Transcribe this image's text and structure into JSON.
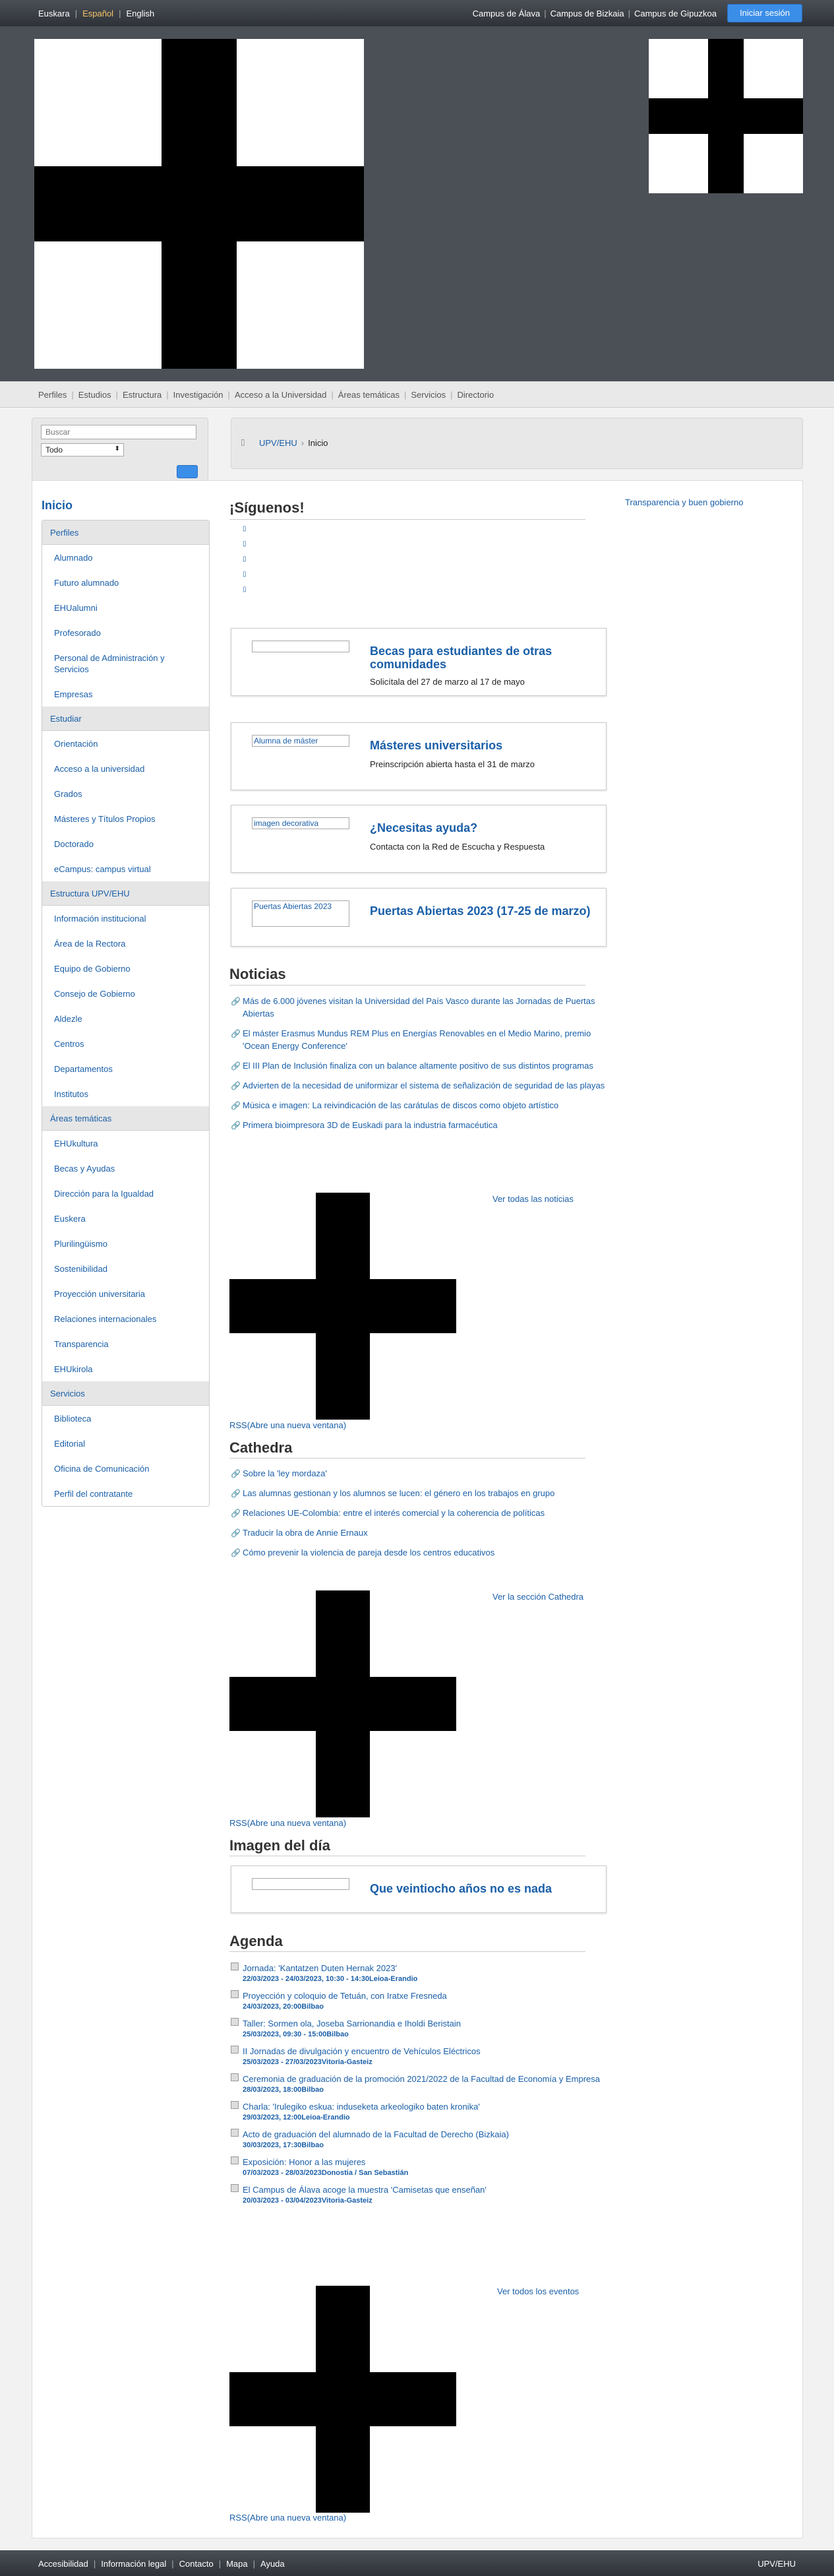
{
  "topbar": {
    "languages": [
      "Euskara",
      "Español",
      "English"
    ],
    "campuses": [
      "Campus de Álava",
      "Campus de Bizkaia",
      "Campus de Gipuzkoa"
    ],
    "login": "Iniciar sesión"
  },
  "menu": [
    "Perfiles",
    "Estudios",
    "Estructura",
    "Investigación",
    "Acceso a la Universidad",
    "Áreas temáticas",
    "Servicios",
    "Directorio"
  ],
  "search": {
    "placeholder": "Buscar",
    "scope": "Todo"
  },
  "breadcrumb": {
    "root": "UPV/EHU",
    "current": "Inicio"
  },
  "left": {
    "title": "Inicio",
    "groups": [
      {
        "head": "Perfiles",
        "items": [
          "Alumnado",
          "Futuro alumnado",
          "EHUalumni",
          "Profesorado",
          "Personal de Administración y Servicios",
          "Empresas"
        ]
      },
      {
        "head": "Estudiar",
        "items": [
          "Orientación",
          "Acceso a la universidad",
          "Grados",
          "Másteres y Títulos Propios",
          "Doctorado",
          "eCampus: campus virtual"
        ]
      },
      {
        "head": "Estructura UPV/EHU",
        "items": [
          "Información institucional",
          "Área de la Rectora",
          "Equipo de Gobierno",
          "Consejo de Gobierno",
          "Aldezle",
          "Centros",
          "Departamentos",
          "Institutos"
        ]
      },
      {
        "head": "Áreas temáticas",
        "items": [
          "EHUkultura",
          "Becas y Ayudas",
          "Dirección para la Igualdad",
          "Euskera",
          "Plurilingüismo",
          "Sostenibilidad",
          "Proyección universitaria",
          "Relaciones internacionales",
          "Transparencia",
          "EHUkirola"
        ]
      },
      {
        "head": "Servicios",
        "items": [
          "Biblioteca",
          "Editorial",
          "Oficina de Comunicación",
          "Perfil del contratante"
        ]
      }
    ]
  },
  "right": {
    "transparency": "Transparencia y buen gobierno"
  },
  "follow": {
    "title": "¡Síguenos!"
  },
  "cards": [
    {
      "img": "",
      "title": "Becas para estudiantes de otras comunidades",
      "text": "Solicítala del 27 de marzo al 17 de mayo"
    },
    {
      "img": "Alumna de máster",
      "title": "Másteres universitarios",
      "text": "Preinscripción abierta hasta el 31 de marzo"
    },
    {
      "img": "imagen decorativa",
      "title": "¿Necesitas ayuda?",
      "text": "Contacta con la Red de Escucha y Respuesta"
    },
    {
      "img": "Puertas Abiertas 2023",
      "title": "Puertas Abiertas 2023 (17-25 de marzo)",
      "text": ""
    }
  ],
  "news": {
    "title": "Noticias",
    "items": [
      "Más de 6.000 jóvenes visitan la Universidad del País Vasco durante las Jornadas de Puertas Abiertas",
      "El máster Erasmus Mundus REM Plus en Energías Renovables en el Medio Marino, premio 'Ocean Energy Conference'",
      "El III Plan de Inclusión finaliza con un balance altamente positivo de sus distintos programas",
      "Advierten de la necesidad de uniformizar el sistema de señalización de seguridad de las playas",
      "Música e imagen: La reivindicación de las carátulas de discos como objeto artístico",
      "Primera bioimpresora 3D de Euskadi para la industria farmacéutica"
    ],
    "see_all": "Ver todas las noticias",
    "rss": "RSS(Abre una nueva ventana)"
  },
  "cathedra": {
    "title": "Cathedra",
    "items": [
      "Sobre la 'ley mordaza'",
      "Las alumnas gestionan y los alumnos se lucen: el género en los trabajos en grupo",
      "Relaciones UE-Colombia: entre el interés comercial y la coherencia de políticas",
      "Traducir la obra de Annie Ernaux",
      "Cómo prevenir la violencia de pareja desde los centros educativos"
    ],
    "see_all": "Ver la sección Cathedra",
    "rss": "RSS(Abre una nueva ventana)"
  },
  "image_of_day": {
    "title": "Imagen del día",
    "caption": "Que veintiocho años no es nada"
  },
  "agenda": {
    "title": "Agenda",
    "items": [
      {
        "t": "Jornada: 'Kantatzen Duten Hernak 2023'",
        "m": "22/03/2023 - 24/03/2023, 10:30 - 14:30Leioa-Erandio"
      },
      {
        "t": "Proyección y coloquio de Tetuán, con Iratxe Fresneda",
        "m": "24/03/2023, 20:00Bilbao"
      },
      {
        "t": "Taller: Sormen ola, Joseba Sarrionandia e Iholdi Beristain",
        "m": "25/03/2023, 09:30 - 15:00Bilbao"
      },
      {
        "t": "II Jornadas de divulgación y encuentro de Vehículos Eléctricos",
        "m": "25/03/2023 - 27/03/2023Vitoria-Gasteiz"
      },
      {
        "t": "Ceremonia de graduación de la promoción 2021/2022 de la Facultad de Economía y Empresa",
        "m": "28/03/2023, 18:00Bilbao"
      },
      {
        "t": "Charla: 'Irulegiko eskua: induseketa arkeologiko baten kronika'",
        "m": "29/03/2023, 12:00Leioa-Erandio"
      },
      {
        "t": "Acto de graduación del alumnado de la Facultad de Derecho (Bizkaia)",
        "m": "30/03/2023, 17:30Bilbao"
      },
      {
        "t": "Exposición: Honor a las mujeres",
        "m": "07/03/2023 - 28/03/2023Donostia / San Sebastián"
      },
      {
        "t": "El Campus de Álava acoge la muestra 'Camisetas que enseñan'",
        "m": "20/03/2023 - 03/04/2023Vitoria-Gasteiz"
      }
    ],
    "see_all": "Ver todos los eventos",
    "rss": "RSS(Abre una nueva ventana)"
  },
  "footer": {
    "links": [
      "Accesibilidad",
      "Información legal",
      "Contacto",
      "Mapa",
      "Ayuda"
    ],
    "brand": "UPV/EHU"
  },
  "colors": {
    "link": "#1a5fa8",
    "button": "#3b8ee8",
    "topbar": "#3a3e44"
  }
}
